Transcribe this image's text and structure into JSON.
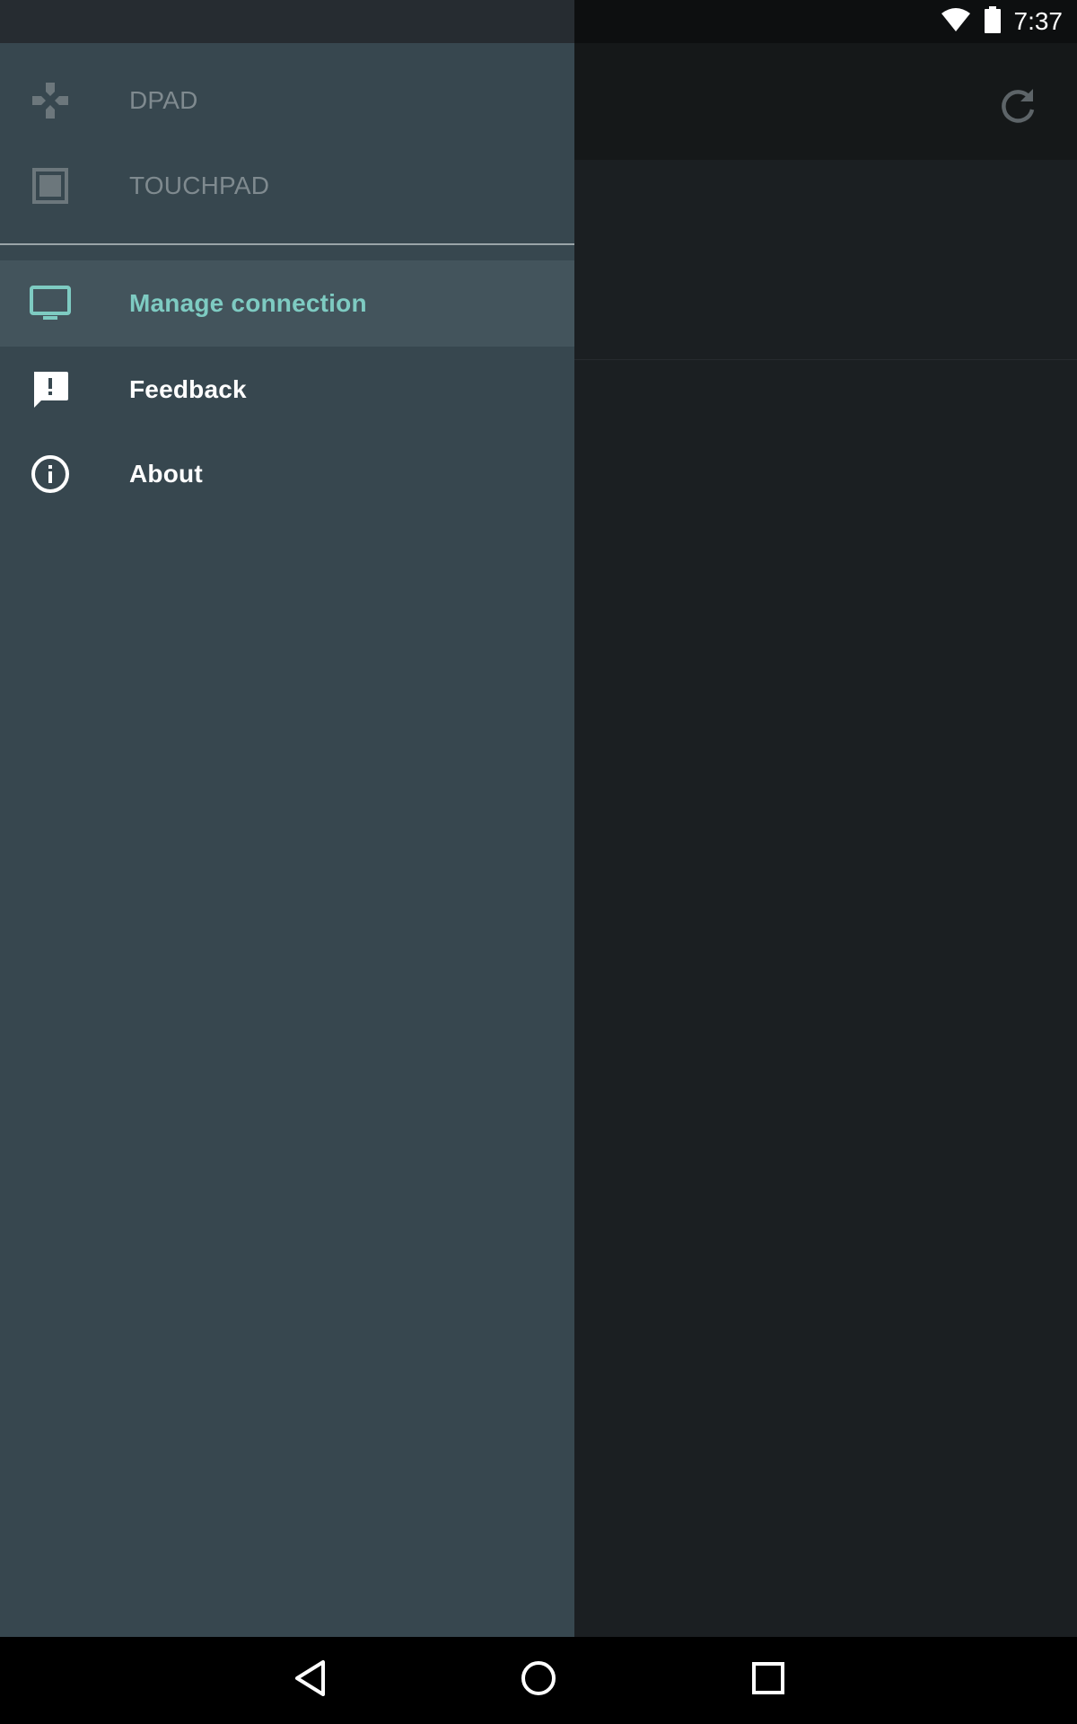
{
  "status_bar": {
    "time": "7:37",
    "icons": [
      "wifi-icon",
      "battery-icon"
    ]
  },
  "app": {
    "toolbar_action_icon": "refresh-icon"
  },
  "drawer": {
    "modes": [
      {
        "label": "DPAD",
        "icon": "gamepad-icon",
        "state": "disabled"
      },
      {
        "label": "TOUCHPAD",
        "icon": "touchpad-icon",
        "state": "disabled"
      }
    ],
    "items": [
      {
        "label": "Manage connection",
        "icon": "tv-icon",
        "state": "selected"
      },
      {
        "label": "Feedback",
        "icon": "feedback-icon",
        "state": "normal"
      },
      {
        "label": "About",
        "icon": "info-icon",
        "state": "normal"
      }
    ]
  },
  "nav_bar": {
    "buttons": [
      "back-icon",
      "home-icon",
      "recents-icon"
    ]
  },
  "colors": {
    "drawer_bg": "#37474f",
    "selected_bg": "#43545c",
    "accent": "#7ecbc2",
    "disabled_text": "#7f8a8f",
    "app_bg": "#1b1f22",
    "toolbar_bg": "#151819"
  }
}
